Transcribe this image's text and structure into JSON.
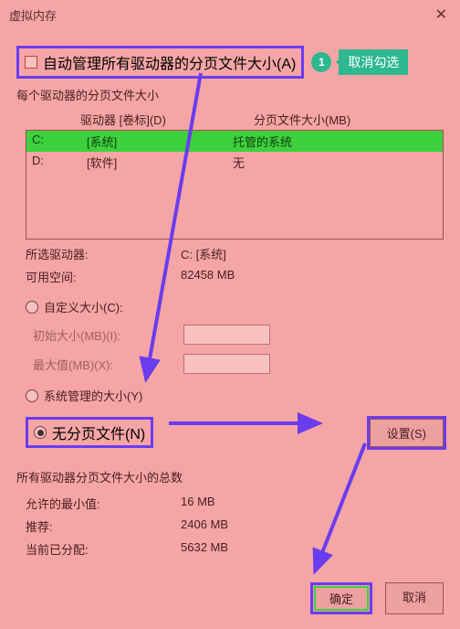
{
  "title": "虚拟内存",
  "auto_manage_label": "自动管理所有驱动器的分页文件大小(A)",
  "badge": "1",
  "tip": "取消勾选",
  "per_drive_label": "每个驱动器的分页文件大小",
  "header_drive": "驱动器 [卷标](D)",
  "header_size": "分页文件大小(MB)",
  "drives": [
    {
      "letter": "C:",
      "label": "[系统]",
      "size": "托管的系统",
      "selected": true
    },
    {
      "letter": "D:",
      "label": "[软件]",
      "size": "无",
      "selected": false
    }
  ],
  "selected_drive_k": "所选驱动器:",
  "selected_drive_v": "C:  [系统]",
  "free_space_k": "可用空间:",
  "free_space_v": "82458 MB",
  "radio_custom": "自定义大小(C):",
  "initial_label": "初始大小(MB)(I):",
  "max_label": "最大值(MB)(X):",
  "radio_system": "系统管理的大小(Y)",
  "radio_none": "无分页文件(N)",
  "set_btn": "设置(S)",
  "totals_label": "所有驱动器分页文件大小的总数",
  "min_k": "允许的最小值:",
  "min_v": "16 MB",
  "rec_k": "推荐:",
  "rec_v": "2406 MB",
  "cur_k": "当前已分配:",
  "cur_v": "5632 MB",
  "ok": "确定",
  "cancel": "取消"
}
